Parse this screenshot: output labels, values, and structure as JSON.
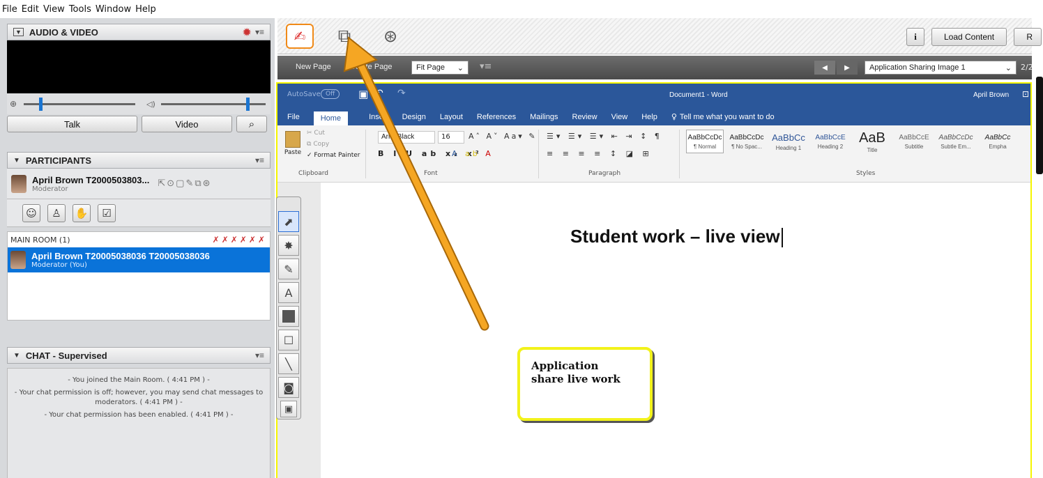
{
  "menubar": {
    "items": [
      "File",
      "Edit",
      "View",
      "Tools",
      "Window",
      "Help"
    ]
  },
  "audio_video": {
    "title": "AUDIO & VIDEO",
    "talk_label": "Talk",
    "video_label": "Video"
  },
  "participants": {
    "title": "PARTICIPANTS",
    "me_name": "April Brown T2000503803...",
    "me_role": "Moderator",
    "room_label": "MAIN ROOM (1)",
    "list": [
      {
        "name": "April Brown T20005038036 T20005038036",
        "role": "Moderator (You)"
      }
    ]
  },
  "chat": {
    "title": "CHAT - Supervised",
    "messages": [
      "- You joined the Main Room. ( 4:41 PM ) -",
      "- Your chat permission is off; however, you may send chat messages to moderators. ( 4:41 PM ) -",
      "- Your chat permission has been enabled. ( 4:41 PM ) -"
    ]
  },
  "toolbar": {
    "load_content": "Load Content",
    "info_icon_label": "i",
    "clipped_label": "R",
    "new_page": "New Page",
    "delete_page": "Delete Page",
    "fit_page": "Fit Page",
    "sharing_select": "Application Sharing Image 1",
    "page_counter": "2/2"
  },
  "word": {
    "autosave": "AutoSave",
    "autosave_state": "Off",
    "doc_title": "Document1 - Word",
    "user": "April Brown",
    "tabs": [
      "File",
      "Home",
      "Insert",
      "Design",
      "Layout",
      "References",
      "Mailings",
      "Review",
      "View",
      "Help"
    ],
    "tell_me": "Tell me what you want to do",
    "clipboard": {
      "paste": "Paste",
      "cut": "Cut",
      "copy": "Copy",
      "format_painter": "Format Painter",
      "group": "Clipboard"
    },
    "font": {
      "name": "Arial Black",
      "size": "16",
      "group": "Font"
    },
    "paragraph_group": "Paragraph",
    "styles_group": "Styles",
    "styles": [
      {
        "sample": "AaBbCcDc",
        "name": "¶ Normal"
      },
      {
        "sample": "AaBbCcDc",
        "name": "¶ No Spac..."
      },
      {
        "sample": "AaBbCc",
        "name": "Heading 1"
      },
      {
        "sample": "AaBbCcE",
        "name": "Heading 2"
      },
      {
        "sample": "AaB",
        "name": "Title"
      },
      {
        "sample": "AaBbCcE",
        "name": "Subtitle"
      },
      {
        "sample": "AaBbCcDc",
        "name": "Subtle Em..."
      },
      {
        "sample": "AaBbCc",
        "name": "Empha"
      }
    ],
    "document_text": "Student work – live view"
  },
  "callout": {
    "text": "Application share live work"
  },
  "colors": {
    "word_blue": "#2b579a",
    "selection_blue": "#0a73d9",
    "arrow_orange": "#f5a623",
    "callout_border": "#f2f21a",
    "highlight_yellow": "#f5f500"
  }
}
